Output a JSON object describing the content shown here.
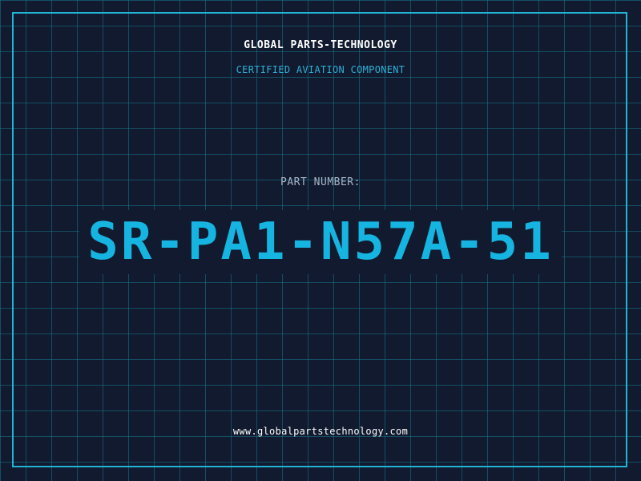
{
  "header": {
    "company": "GLOBAL PARTS-TECHNOLOGY",
    "tagline": "CERTIFIED AVIATION COMPONENT"
  },
  "part": {
    "label": "PART NUMBER:",
    "number": "SR-PA1-N57A-51"
  },
  "footer": {
    "website": "www.globalpartstechnology.com"
  },
  "colors": {
    "background": "#111a2e",
    "grid": "#17788c",
    "accent": "#16b4e0",
    "text": "#ffffff",
    "muted": "#a7b4c6"
  }
}
